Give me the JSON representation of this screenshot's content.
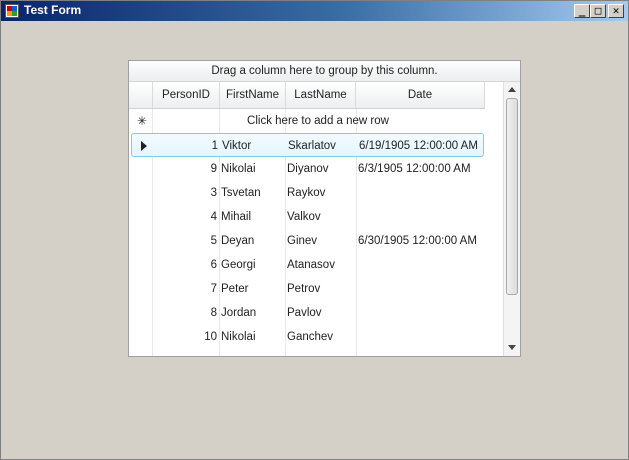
{
  "window": {
    "title": "Test Form",
    "buttons": {
      "minimize": "_",
      "maximize": "□",
      "close": "✕"
    }
  },
  "grid": {
    "group_panel_text": "Drag a column here to group by this column.",
    "columns": [
      "PersonID",
      "FirstName",
      "LastName",
      "Date"
    ],
    "new_row_text": "Click here to add a new row",
    "new_row_icon": "asterisk-icon",
    "rows": [
      {
        "id": "1",
        "first": "Viktor",
        "last": "Skarlatov",
        "date": "6/19/1905 12:00:00 AM"
      },
      {
        "id": "9",
        "first": "Nikolai",
        "last": "Diyanov",
        "date": "6/3/1905 12:00:00 AM"
      },
      {
        "id": "3",
        "first": "Tsvetan",
        "last": "Raykov",
        "date": ""
      },
      {
        "id": "4",
        "first": "Mihail",
        "last": "Valkov",
        "date": ""
      },
      {
        "id": "5",
        "first": "Deyan",
        "last": "Ginev",
        "date": "6/30/1905 12:00:00 AM"
      },
      {
        "id": "6",
        "first": "Georgi",
        "last": "Atanasov",
        "date": ""
      },
      {
        "id": "7",
        "first": "Peter",
        "last": "Petrov",
        "date": ""
      },
      {
        "id": "8",
        "first": "Jordan",
        "last": "Pavlov",
        "date": ""
      },
      {
        "id": "10",
        "first": "Nikolai",
        "last": "Ganchev",
        "date": ""
      }
    ],
    "selected_row_index": 0
  }
}
